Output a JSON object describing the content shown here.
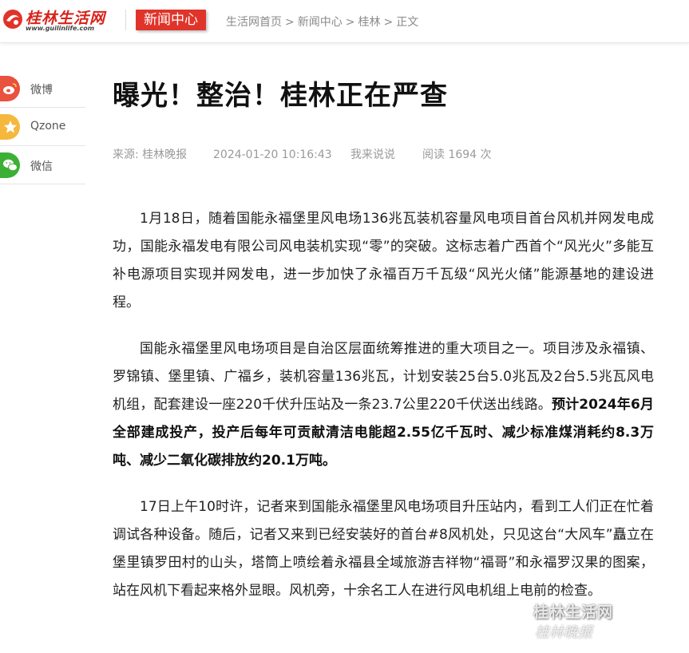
{
  "header": {
    "logo_text": "桂林生活网",
    "logo_url": "www.guilinlife.com",
    "section_label": "新闻中心",
    "breadcrumb": [
      "生活网首页",
      "新闻中心",
      "桂林",
      "正文"
    ],
    "breadcrumb_separator": ">",
    "colors": {
      "brand_red": "#d8231b",
      "section_bg": "#e0342a"
    }
  },
  "share": {
    "items": [
      {
        "label": "微博",
        "icon": "weibo-icon",
        "color": "#e8523f"
      },
      {
        "label": "Qzone",
        "icon": "qzone-icon",
        "color": "#f5b83d"
      },
      {
        "label": "微信",
        "icon": "wechat-icon",
        "color": "#3cb034"
      }
    ]
  },
  "article": {
    "title": "曝光！整治！桂林正在严查",
    "meta": {
      "source": "来源: 桂林晚报",
      "date": "2024-01-20 10:16:43",
      "comment": "我来说说",
      "views": "阅读 1694 次"
    },
    "paragraphs": [
      {
        "text": "1月18日，随着国能永福堡里风电场136兆瓦装机容量风电项目首台风机并网发电成功，国能永福发电有限公司风电装机实现“零”的突破。这标志着广西首个“风光火”多能互补电源项目实现并网发电，进一步加快了永福百万千瓦级“风光火储”能源基地的建设进程。",
        "bold": ""
      },
      {
        "text": "国能永福堡里风电场项目是自治区层面统筹推进的重大项目之一。项目涉及永福镇、罗锦镇、堡里镇、广福乡，装机容量136兆瓦，计划安装25台5.0兆瓦及2台5.5兆瓦风电机组，配套建设一座220千伏升压站及一条23.7公里220千伏送出线路。",
        "bold": "预计2024年6月全部建成投产，投产后每年可贡献清洁电能超2.55亿千瓦时、减少标准煤消耗约8.3万吨、减少二氧化碳排放约20.1万吨。"
      },
      {
        "text": "17日上午10时许，记者来到国能永福堡里风电场项目升压站内，看到工人们正在忙着调试各种设备。随后，记者又来到已经安装好的首台#8风机处，只见这台“大风车”矗立在堡里镇罗田村的山头，塔筒上喷绘着永福县全域旅游吉祥物“福哥”和永福罗汉果的图案，站在风机下看起来格外显眼。风机旁，十余名工人在进行风电机组上电前的检查。",
        "bold": ""
      }
    ]
  },
  "watermark": {
    "line1": "桂林生活网",
    "line2": "桂林晚报"
  }
}
